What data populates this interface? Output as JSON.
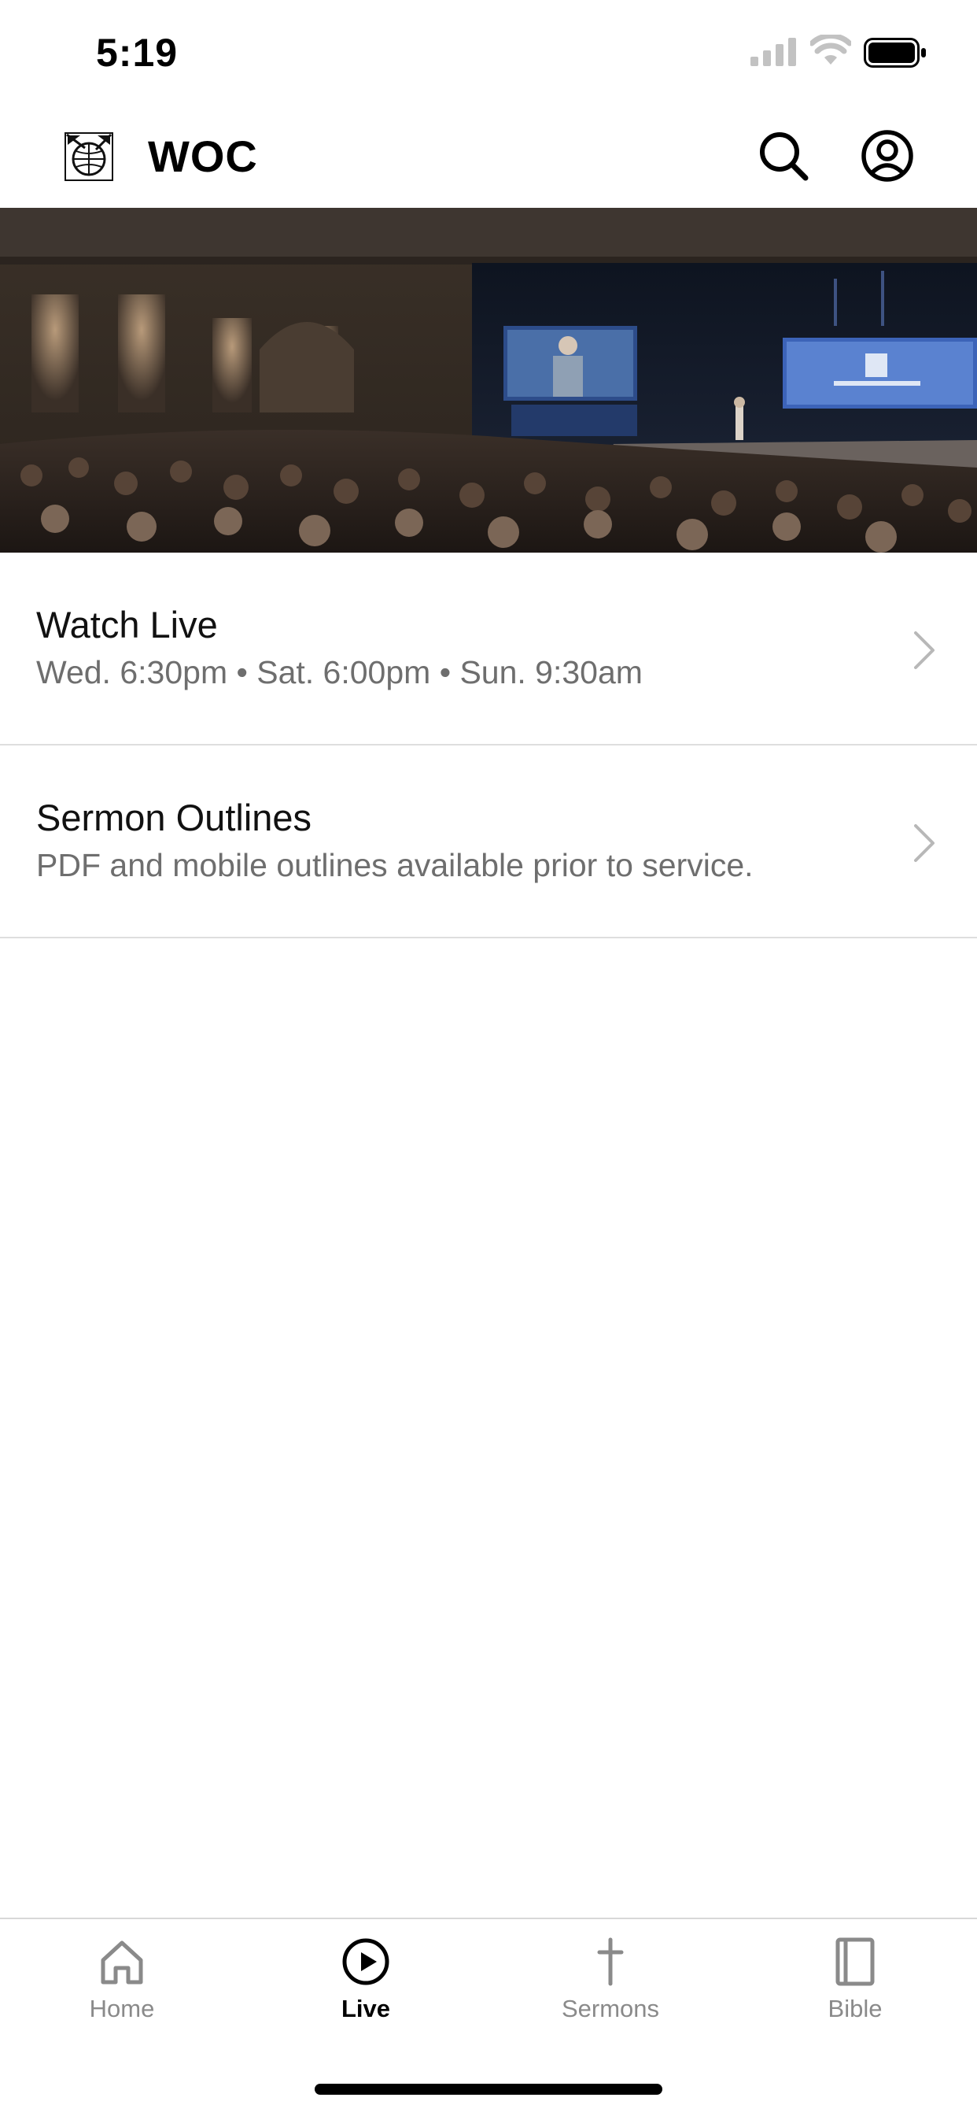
{
  "status_bar": {
    "time": "5:19"
  },
  "header": {
    "title": "WOC",
    "logo_icon": "woc-globe-logo-icon",
    "search_icon": "search-icon",
    "profile_icon": "user-circle-icon"
  },
  "hero": {
    "image": "church-auditorium-photo"
  },
  "list": {
    "items": [
      {
        "title": "Watch Live",
        "subtitle": "Wed. 6:30pm • Sat. 6:00pm • Sun. 9:30am",
        "icon": "chevron-right-icon"
      },
      {
        "title": "Sermon Outlines",
        "subtitle": "PDF and mobile outlines available prior to service.",
        "icon": "chevron-right-icon"
      }
    ]
  },
  "tabbar": {
    "tabs": [
      {
        "label": "Home",
        "icon": "home-icon",
        "active": false
      },
      {
        "label": "Live",
        "icon": "play-circle-icon",
        "active": true
      },
      {
        "label": "Sermons",
        "icon": "cross-icon",
        "active": false
      },
      {
        "label": "Bible",
        "icon": "book-icon",
        "active": false
      }
    ]
  },
  "colors": {
    "active": "#000000",
    "inactive": "#8a8a8a",
    "subtitle": "#6e6e6e",
    "divider": "#dedede"
  }
}
